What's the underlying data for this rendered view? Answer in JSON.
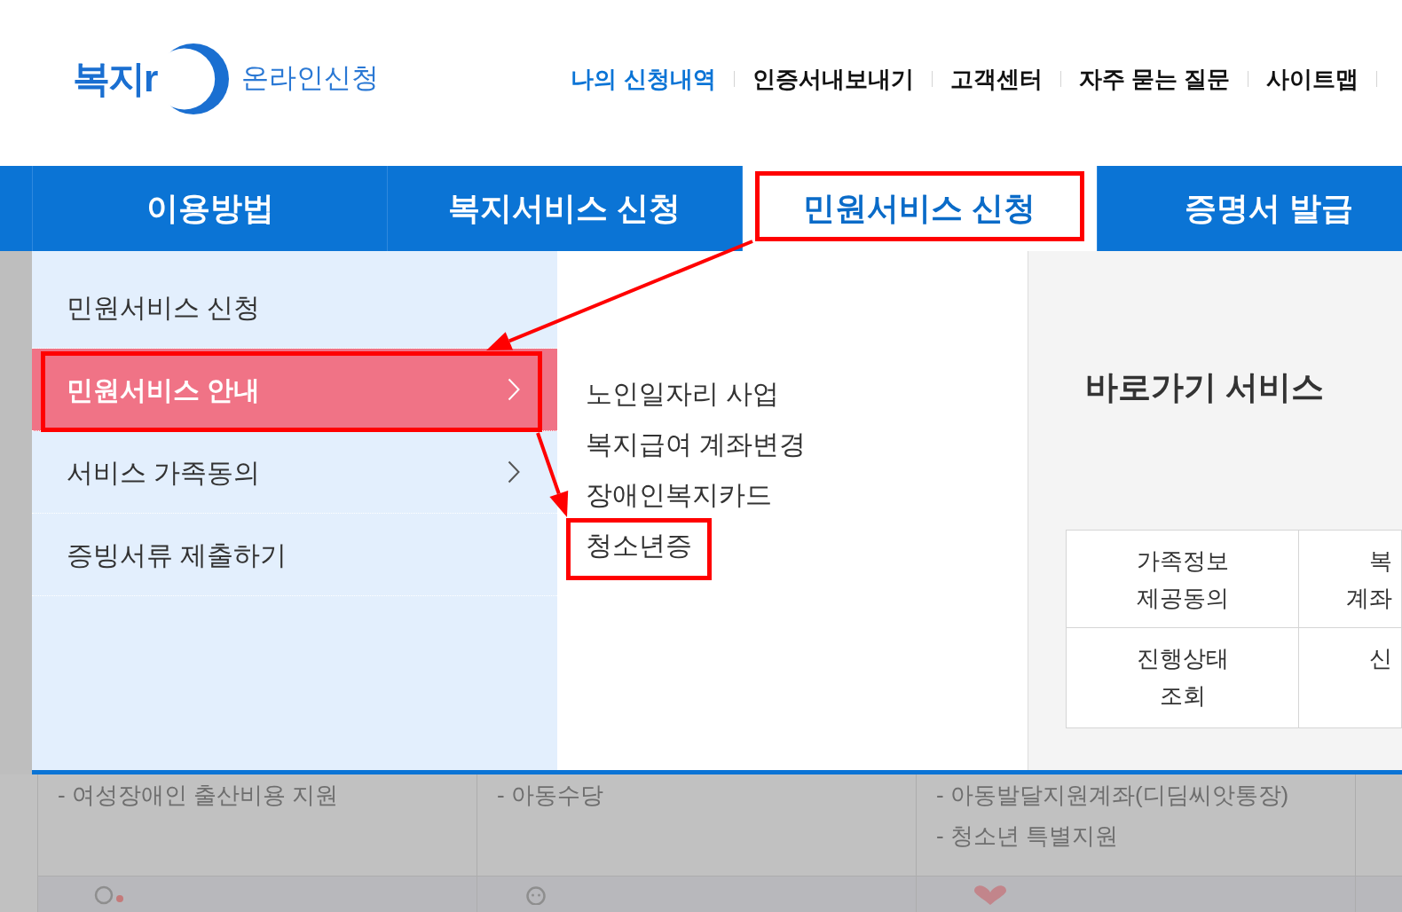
{
  "header": {
    "logo": {
      "wordmark": "복지r",
      "subtitle": "온라인신청"
    },
    "links": [
      {
        "label": "나의 신청내역",
        "kind": "primary"
      },
      {
        "label": "인증서내보내기",
        "kind": "default"
      },
      {
        "label": "고객센터",
        "kind": "default"
      },
      {
        "label": "자주 묻는 질문",
        "kind": "default"
      },
      {
        "label": "사이트맵",
        "kind": "default"
      }
    ]
  },
  "nav": {
    "tabs": [
      {
        "label": "이용방법",
        "selected": false,
        "highlighted": false
      },
      {
        "label": "복지서비스 신청",
        "selected": false,
        "highlighted": false
      },
      {
        "label": "민원서비스 신청",
        "selected": true,
        "highlighted": true
      },
      {
        "label": "증명서 발급",
        "selected": false,
        "highlighted": false
      }
    ]
  },
  "dropdown": {
    "menu": [
      {
        "label": "민원서비스 신청",
        "selected": false,
        "has_submenu": false,
        "highlighted": false
      },
      {
        "label": "민원서비스 안내",
        "selected": true,
        "has_submenu": true,
        "highlighted": true
      },
      {
        "label": "서비스 가족동의",
        "selected": false,
        "has_submenu": true,
        "highlighted": false
      },
      {
        "label": "증빙서류 제출하기",
        "selected": false,
        "has_submenu": false,
        "highlighted": false
      }
    ],
    "submenu": [
      {
        "label": "노인일자리 사업",
        "highlighted": false
      },
      {
        "label": "복지급여 계좌변경",
        "highlighted": false
      },
      {
        "label": "장애인복지카드",
        "highlighted": false
      },
      {
        "label": "청소년증",
        "highlighted": true
      }
    ],
    "quick_links": {
      "title": "바로가기 서비스",
      "rows": [
        [
          "가족정보\n제공동의",
          "복\n계좌"
        ],
        [
          "진행상태\n조회",
          "신"
        ]
      ]
    }
  },
  "background_table": {
    "columns": [
      [
        "- 여성장애인 출산비용 지원"
      ],
      [
        "- 아동수당"
      ],
      [
        "- 아동발달지원계좌(디딤씨앗통장)",
        "- 청소년 특별지원"
      ]
    ]
  }
}
